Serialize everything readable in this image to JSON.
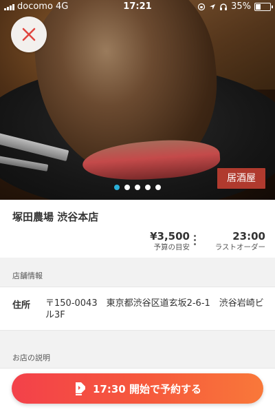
{
  "statusbar": {
    "carrier": "docomo",
    "network": "4G",
    "time": "17:21",
    "battery": "35%"
  },
  "hero": {
    "category_badge": "居酒屋",
    "carousel_count": 5,
    "carousel_active": 1
  },
  "shop": {
    "name": "塚田農場 渋谷本店",
    "budget_value": "¥3,500",
    "budget_label": "予算の目安",
    "last_order_value": "23:00",
    "last_order_label": "ラストオーダー"
  },
  "store_info": {
    "section_title": "店舗情報",
    "address_key": "住所",
    "address_value": "〒150-0043　東京都渋谷区道玄坂2-6-1　渋谷岩崎ビル3F"
  },
  "description": {
    "section_title": "お店の説明"
  },
  "cta": {
    "label": "17:30 開始で予約する"
  },
  "colors": {
    "accent": "#f3414a",
    "badge": "#b03a2e",
    "dot_active": "#2ab0d8"
  }
}
